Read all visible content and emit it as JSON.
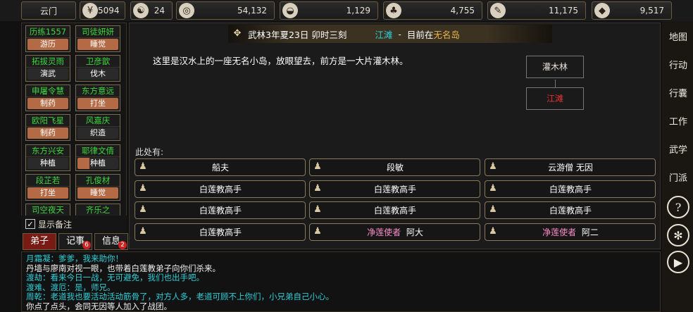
{
  "topbar": {
    "location": "云门",
    "resources": [
      {
        "icon": "coin-bag-icon",
        "glyph": "¥",
        "value": "5094"
      },
      {
        "icon": "yin-yang-icon",
        "glyph": "☯",
        "value": "24"
      },
      {
        "icon": "coin-icon",
        "glyph": "◎",
        "value": "54,132"
      },
      {
        "icon": "food-bowl-icon",
        "glyph": "◒",
        "value": "1,129"
      },
      {
        "icon": "herb-icon",
        "glyph": "♣",
        "value": "4,755"
      },
      {
        "icon": "wood-icon",
        "glyph": "✎",
        "value": "11,175"
      },
      {
        "icon": "ore-icon",
        "glyph": "◆",
        "value": "9,517"
      }
    ]
  },
  "disciples": [
    {
      "name": "历练1557",
      "action": "游历",
      "progress": 1.0
    },
    {
      "name": "司徒妍妍",
      "action": "睡觉",
      "progress": 1.0
    },
    {
      "name": "拓拔灵雨",
      "action": "演武",
      "progress": 0.0
    },
    {
      "name": "卫彦歆",
      "action": "伐木",
      "progress": 0.0
    },
    {
      "name": "申屠令慧",
      "action": "制药",
      "progress": 1.0
    },
    {
      "name": "东方意远",
      "action": "打坐",
      "progress": 1.0
    },
    {
      "name": "欧阳飞星",
      "action": "制药",
      "progress": 1.0
    },
    {
      "name": "风嘉庆",
      "action": "织造",
      "progress": 0.0
    },
    {
      "name": "东方兴安",
      "action": "种植",
      "progress": 0.0
    },
    {
      "name": "耶律文倩",
      "action": "种植",
      "progress": 0.3
    },
    {
      "name": "段芷若",
      "action": "打坐",
      "progress": 1.0
    },
    {
      "name": "孔俊材",
      "action": "睡觉",
      "progress": 1.0
    },
    {
      "name": "司空夜天",
      "action": "",
      "progress": 0.0
    },
    {
      "name": "齐乐之",
      "action": "",
      "progress": 0.0
    }
  ],
  "notes_label": "显示备注",
  "tabs": [
    {
      "label": "弟子",
      "badge": ""
    },
    {
      "label": "记事",
      "badge": "6"
    },
    {
      "label": "信息",
      "badge": "2"
    }
  ],
  "header": {
    "date": "武林3年夏23日 卯时三刻",
    "area": "江滩",
    "sep": "-",
    "current_prefix": "目前在",
    "place": "无名岛"
  },
  "description": "这里是汉水上的一座无名小岛，放眼望去，前方是一大片灌木林。",
  "map": {
    "north": "灌木林",
    "current": "江滩"
  },
  "here_label": "此处有:",
  "npcs": [
    {
      "prefix": "",
      "name": "船夫"
    },
    {
      "prefix": "",
      "name": "段敏"
    },
    {
      "prefix": "",
      "name": "云游僧 无因"
    },
    {
      "prefix": "",
      "name": "白莲教高手"
    },
    {
      "prefix": "",
      "name": "白莲教高手"
    },
    {
      "prefix": "",
      "name": "白莲教高手"
    },
    {
      "prefix": "",
      "name": "白莲教高手"
    },
    {
      "prefix": "",
      "name": "白莲教高手"
    },
    {
      "prefix": "",
      "name": "白莲教高手"
    },
    {
      "prefix": "",
      "name": "白莲教高手"
    },
    {
      "prefix": "净莲使者",
      "name": "阿大"
    },
    {
      "prefix": "净莲使者",
      "name": "阿二"
    }
  ],
  "log": [
    {
      "text": "月霜凝：爹爹，我来助你！",
      "color": "cyan"
    },
    {
      "text": "丹墙与廖南对视一眼，也带着白莲教弟子向你们杀来。",
      "color": "white"
    },
    {
      "text": "渡劫：看来今日一战，无可避免，我们也出手吧。",
      "color": "cyan"
    },
    {
      "text": "渡难、渡厄：是，师兄。",
      "color": "cyan"
    },
    {
      "text": "周乾：老道我也要活动活动筋骨了，对方人多，老道可顾不上你们，小兄弟自己小心。",
      "color": "cyan"
    },
    {
      "text": "你点了点头，会同无因等人加入了战团。",
      "color": "white"
    }
  ],
  "sidebar": [
    {
      "label": "地图",
      "icon": "map-icon"
    },
    {
      "label": "行动",
      "icon": "action-icon"
    },
    {
      "label": "行囊",
      "icon": "bag-icon"
    },
    {
      "label": "工作",
      "icon": "work-icon"
    },
    {
      "label": "武学",
      "icon": "martial-icon"
    },
    {
      "label": "门派",
      "icon": "sect-icon"
    },
    {
      "label": "?",
      "icon": "help-icon"
    },
    {
      "label": "✻",
      "icon": "settings-gear-icon"
    },
    {
      "label": "▶",
      "icon": "play-icon"
    }
  ]
}
